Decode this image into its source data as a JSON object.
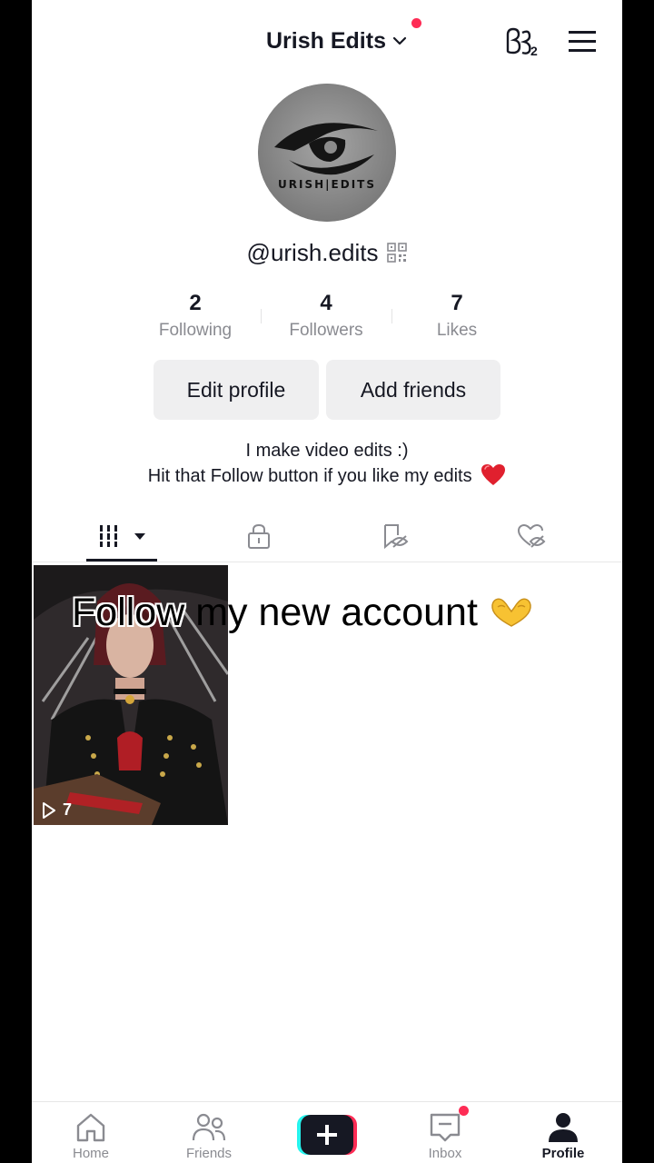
{
  "header": {
    "account_name": "Urish Edits",
    "icons": [
      "chevron-down-icon",
      "creator-tools-icon",
      "menu-icon"
    ],
    "notification_color": "#fe2c55"
  },
  "avatar": {
    "logo_text": "URISH|EDITS"
  },
  "profile": {
    "username": "@urish.edits",
    "stats": [
      {
        "value": "2",
        "label": "Following"
      },
      {
        "value": "4",
        "label": "Followers"
      },
      {
        "value": "7",
        "label": "Likes"
      }
    ],
    "edit_button": "Edit profile",
    "add_friends_button": "Add friends",
    "bio_line1": "I make video edits :)",
    "bio_line2": "Hit that Follow button if you like my edits",
    "bio_emoji": "heart-emoji"
  },
  "tabs": [
    {
      "name": "videos",
      "icon": "grid-icon",
      "active": true
    },
    {
      "name": "private",
      "icon": "lock-icon",
      "active": false
    },
    {
      "name": "reposts",
      "icon": "hidden-bookmark-icon",
      "active": false
    },
    {
      "name": "liked",
      "icon": "hidden-heart-icon",
      "active": false
    }
  ],
  "videos": [
    {
      "views": "7",
      "thumbnail": "character-in-studded-jacket"
    }
  ],
  "overlay": {
    "caption_outlined": "Follow",
    "caption_rest": "my new account",
    "emoji": "heart-hands-emoji"
  },
  "bottom_nav": {
    "home": "Home",
    "friends": "Friends",
    "inbox": "Inbox",
    "profile": "Profile",
    "active": "Profile",
    "create_icon": "plus-icon"
  },
  "colors": {
    "accent": "#fe2c55",
    "text": "#161823",
    "secondary_text": "#8a8b91",
    "button_bg": "#efeff0"
  }
}
